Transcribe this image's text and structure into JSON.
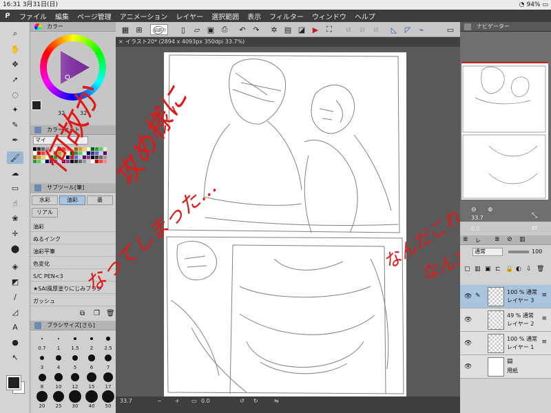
{
  "status": {
    "time": "16:31",
    "date": "3月31日(日)",
    "battery": "94%"
  },
  "menu": [
    "ファイル",
    "編集",
    "ページ管理",
    "アニメーション",
    "レイヤー",
    "選択範囲",
    "表示",
    "フィルター",
    "ウィンドウ",
    "ヘルプ"
  ],
  "doc_tab": "イラスト20* (2894 x 4093px 350dpi 33.7%)",
  "color_panel": {
    "title": "カラー",
    "num1": "32",
    "num2": "32"
  },
  "color_set": {
    "title": "カラーセット",
    "selector": "マイ"
  },
  "subtool": {
    "title": "サブツール[筆]",
    "tabs": [
      "水彩",
      "油彩",
      "墨",
      "リアル"
    ],
    "items": [
      "油彩",
      "ぬるインク",
      "油彩平筆",
      "色変化",
      "S/C PEN<3",
      "★SAI風厚塗りにじみブラシ",
      "ガッシュ"
    ]
  },
  "brush_size": {
    "title": "ブラシサイズ[さら]",
    "sizes": [
      "0.7",
      "1",
      "1.5",
      "2",
      "2.5",
      "3",
      "4",
      "5",
      "6",
      "7",
      "8",
      "10",
      "12",
      "15",
      "17",
      "20",
      "25",
      "30",
      "40",
      "50"
    ]
  },
  "navigator": {
    "title": "ナビゲーター",
    "zoom": "33.7",
    "rotation": "0.0"
  },
  "layers": {
    "tab": "レ",
    "blend": "通常",
    "opacity": "100",
    "rows": [
      {
        "line1": "100 % 通常",
        "line2": "レイヤー 3",
        "selected": true
      },
      {
        "line1": "49 % 通常",
        "line2": "レイヤー 2",
        "selected": false
      },
      {
        "line1": "100 % 通常",
        "line2": "レイヤー 1",
        "selected": false
      },
      {
        "line1": "",
        "line2": "用紙",
        "selected": false
      }
    ]
  },
  "bottom": {
    "zoom": "33.7",
    "rotation": "0.0"
  },
  "annotations": {
    "a1": "何故か",
    "a2": "攻め様に",
    "a3": "なってしまった…",
    "a4": "なんだこれ",
    "a5": "なんだこれ…"
  },
  "colors": {
    "accent": "#e01818",
    "selection": "#a9c4de",
    "menubar": "#3c3c3c"
  }
}
